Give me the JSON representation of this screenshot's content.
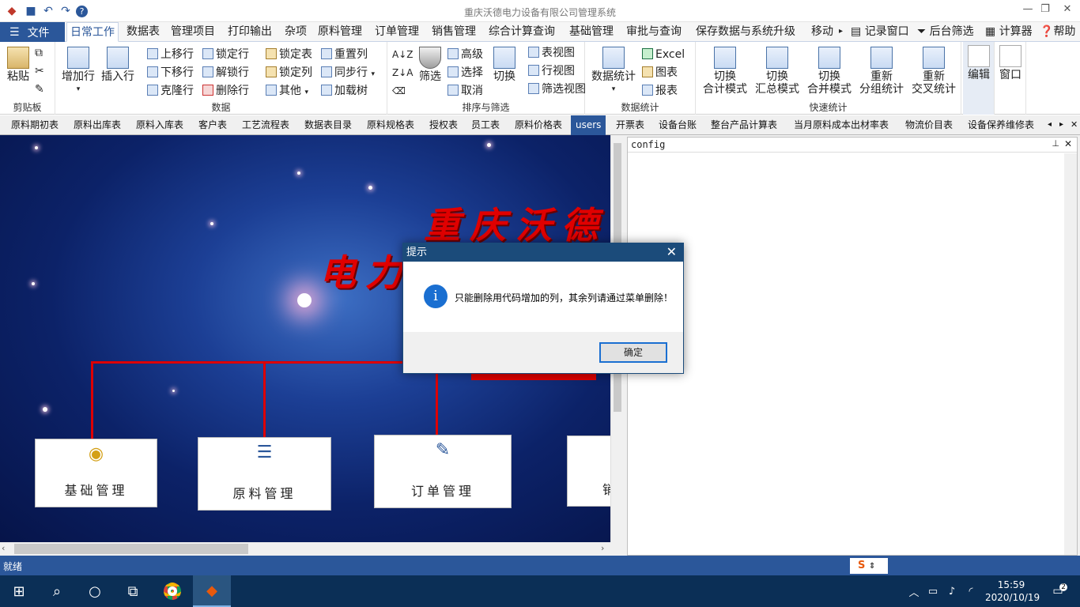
{
  "window": {
    "title": "重庆沃德电力设备有限公司管理系统"
  },
  "menu": {
    "file": "文件",
    "tabs": [
      "日常工作",
      "数据表",
      "管理项目",
      "打印输出",
      "杂项",
      "原料管理",
      "订单管理",
      "销售管理",
      "综合计算查询",
      "基础管理",
      "审批与查询",
      "保存数据与系统升级",
      "移动"
    ],
    "right": [
      "记录窗口",
      "后台筛选",
      "计算器",
      "帮助"
    ]
  },
  "ribbon": {
    "clipboard": {
      "label": "剪贴板",
      "paste": "粘贴"
    },
    "data": {
      "label": "数据",
      "add_row": "增加行",
      "insert_row": "插入行",
      "move_up": "上移行",
      "move_down": "下移行",
      "clone_row": "克隆行",
      "lock_row": "锁定行",
      "unlock_row": "解锁行",
      "delete_row": "删除行",
      "lock_table": "锁定表",
      "lock_col": "锁定列",
      "other": "其他",
      "reset_col": "重置列",
      "sync_row": "同步行",
      "load_tree": "加载树"
    },
    "sort": {
      "label": "排序与筛选",
      "filter": "筛选",
      "advanced": "高级",
      "select": "选择",
      "cancel": "取消",
      "switch": "切换",
      "table_view": "表视图",
      "row_view": "行视图",
      "filter_view": "筛选视图"
    },
    "stats": {
      "label": "数据统计",
      "data_stats": "数据统计",
      "excel": "Excel",
      "chart": "图表",
      "report": "报表"
    },
    "quick": {
      "label": "快速统计",
      "b1": [
        "切换",
        "合计模式"
      ],
      "b2": [
        "切换",
        "汇总模式"
      ],
      "b3": [
        "切换",
        "合并模式"
      ],
      "b4": [
        "重新",
        "分组统计"
      ],
      "b5": [
        "重新",
        "交叉统计"
      ]
    },
    "edit": "编辑",
    "window": "窗口"
  },
  "sheet_tabs": [
    "原料期初表",
    "原料出库表",
    "原料入库表",
    "客户表",
    "工艺流程表",
    "数据表目录",
    "原料规格表",
    "授权表",
    "员工表",
    "原料价格表",
    "users",
    "开票表",
    "设备台账",
    "整台产品计算表",
    "当月原料成本出材率表",
    "物流价目表",
    "设备保养维修表"
  ],
  "active_sheet": "users",
  "canvas": {
    "title_line1": "重庆沃德",
    "title_line2": "电力",
    "nodes": [
      "基础管理",
      "原料管理",
      "订单管理",
      "销"
    ]
  },
  "config_panel": {
    "title": "config"
  },
  "status": {
    "text": "就绪"
  },
  "dialog": {
    "title": "提示",
    "message": "只能删除用代码增加的列，其余列请通过菜单删除！",
    "ok": "确定"
  },
  "taskbar": {
    "time": "15:59",
    "date": "2020/10/19",
    "notifications": "2"
  }
}
